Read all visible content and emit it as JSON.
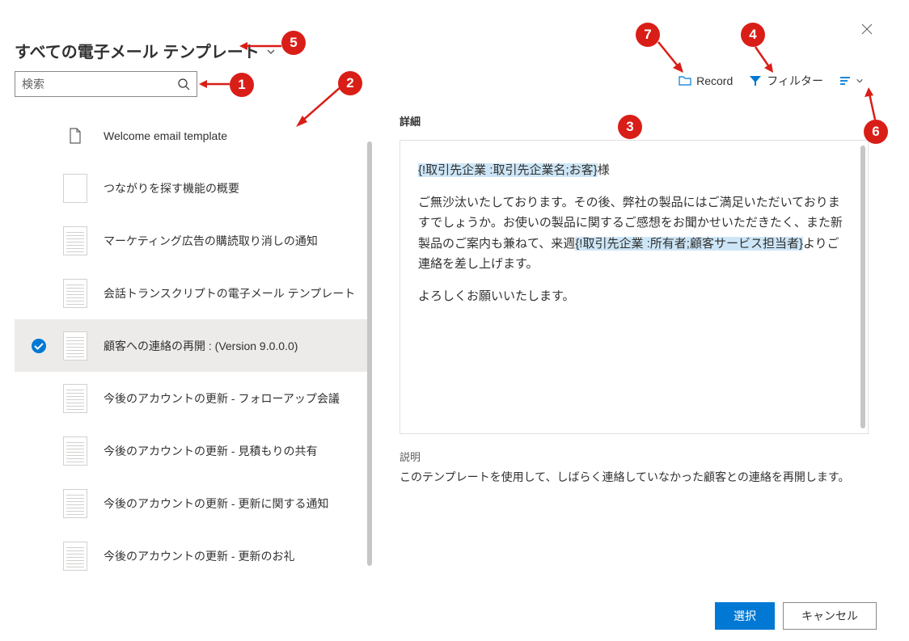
{
  "title": "すべての電子メール テンプレート",
  "search": {
    "placeholder": "検索"
  },
  "toolbar": {
    "record": "Record",
    "filter": "フィルター"
  },
  "list": [
    {
      "label": "Welcome email template",
      "selected": false,
      "thumb": "doc"
    },
    {
      "label": "つながりを探す機能の概要",
      "selected": false,
      "thumb": "blank"
    },
    {
      "label": "マーケティング広告の購読取り消しの通知",
      "selected": false,
      "thumb": "lines"
    },
    {
      "label": "会話トランスクリプトの電子メール テンプレート",
      "selected": false,
      "thumb": "lines"
    },
    {
      "label": "顧客への連絡の再開 : (Version 9.0.0.0)",
      "selected": true,
      "thumb": "lines"
    },
    {
      "label": "今後のアカウントの更新 - フォローアップ会議",
      "selected": false,
      "thumb": "lines"
    },
    {
      "label": "今後のアカウントの更新 - 見積もりの共有",
      "selected": false,
      "thumb": "lines"
    },
    {
      "label": "今後のアカウントの更新 - 更新に関する通知",
      "selected": false,
      "thumb": "lines"
    },
    {
      "label": "今後のアカウントの更新 - 更新のお礼",
      "selected": false,
      "thumb": "lines"
    }
  ],
  "detail": {
    "header": "詳細",
    "body": {
      "h1": "{!取引先企業 :取引先企業名;お客}",
      "t1": "様",
      "p1": "ご無沙汰いたしております。その後、弊社の製品にはご満足いただいておりますでしょうか。お使いの製品に関するご感想をお聞かせいただきたく、また新製品のご案内も兼ねて、来週",
      "h2": "{!取引先企業 :所有者;顧客サービス担当者}",
      "t2": "よりご連絡を差し上げます。",
      "p2": "よろしくお願いいたします。"
    },
    "desc_h": "説明",
    "desc_t": "このテンプレートを使用して、しばらく連絡していなかった顧客との連絡を再開します。"
  },
  "actions": {
    "select": "選択",
    "cancel": "キャンセル"
  },
  "callouts": [
    "1",
    "2",
    "3",
    "4",
    "5",
    "6",
    "7"
  ]
}
